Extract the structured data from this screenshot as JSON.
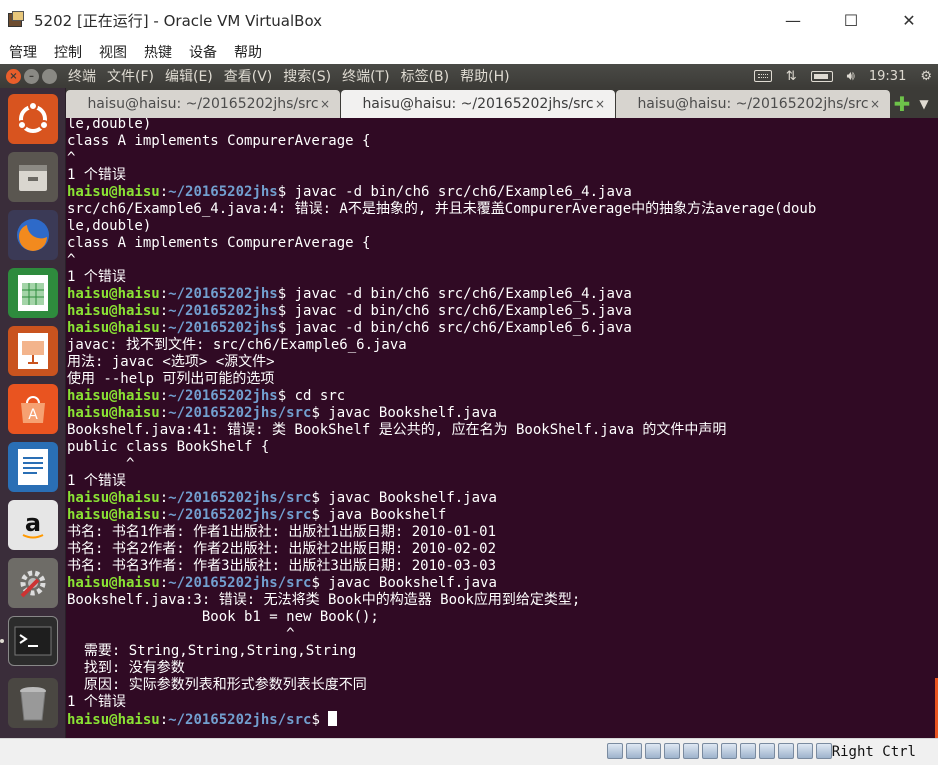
{
  "host_window": {
    "title": "5202 [正在运行] - Oracle VM VirtualBox",
    "controls": {
      "minimize": "—",
      "maximize": "☐",
      "close": "✕"
    },
    "menu": [
      "管理",
      "控制",
      "视图",
      "热键",
      "设备",
      "帮助"
    ]
  },
  "guest_panel": {
    "menu": [
      "终端",
      "文件(F)",
      "编辑(E)",
      "查看(V)",
      "搜索(S)",
      "终端(T)",
      "标签(B)",
      "帮助(H)"
    ],
    "time": "19:31",
    "indicators": [
      "keyboard-icon",
      "network-icon",
      "battery-icon",
      "volume-icon",
      "gear-icon"
    ]
  },
  "launcher": {
    "items": [
      {
        "name": "ubuntu-dash-icon",
        "color": "#d8541f"
      },
      {
        "name": "files-icon",
        "color": "#7a7a72"
      },
      {
        "name": "firefox-icon",
        "color": "#e66000"
      },
      {
        "name": "libreoffice-calc-icon",
        "color": "#2e8b3d"
      },
      {
        "name": "libreoffice-impress-icon",
        "color": "#c9531e"
      },
      {
        "name": "software-center-icon",
        "color": "#e95420"
      },
      {
        "name": "libreoffice-writer-icon",
        "color": "#2a6fb5"
      },
      {
        "name": "amazon-icon",
        "color": "#e0e0e0"
      },
      {
        "name": "system-settings-icon",
        "color": "#9a9a9a"
      },
      {
        "name": "terminal-icon",
        "color": "#2c2c2c"
      },
      {
        "name": "trash-icon",
        "color": "#8a8a8a"
      }
    ]
  },
  "tabs": [
    {
      "label": "haisu@haisu: ~/20165202jhs/src",
      "active": false
    },
    {
      "label": "haisu@haisu: ~/20165202jhs/src",
      "active": true
    },
    {
      "label": "haisu@haisu: ~/20165202jhs/src",
      "active": false
    }
  ],
  "tab_close_glyph": "×",
  "terminal": {
    "lines": [
      {
        "text": "le,double)"
      },
      {
        "text": "class A implements CompurerAverage {"
      },
      {
        "text": "^"
      },
      {
        "text": "1 个错误"
      },
      {
        "user": "haisu@haisu",
        "path": "~/20165202jhs",
        "cmd": " javac -d bin/ch6 src/ch6/Example6_4.java"
      },
      {
        "text": "src/ch6/Example6_4.java:4: 错误: A不是抽象的, 并且未覆盖CompurerAverage中的抽象方法average(doub"
      },
      {
        "text": "le,double)"
      },
      {
        "text": "class A implements CompurerAverage {"
      },
      {
        "text": "^"
      },
      {
        "text": "1 个错误"
      },
      {
        "user": "haisu@haisu",
        "path": "~/20165202jhs",
        "cmd": " javac -d bin/ch6 src/ch6/Example6_4.java"
      },
      {
        "user": "haisu@haisu",
        "path": "~/20165202jhs",
        "cmd": " javac -d bin/ch6 src/ch6/Example6_5.java"
      },
      {
        "user": "haisu@haisu",
        "path": "~/20165202jhs",
        "cmd": " javac -d bin/ch6 src/ch6/Example6_6.java"
      },
      {
        "text": "javac: 找不到文件: src/ch6/Example6_6.java"
      },
      {
        "text": "用法: javac <选项> <源文件>"
      },
      {
        "text": "使用 --help 可列出可能的选项"
      },
      {
        "user": "haisu@haisu",
        "path": "~/20165202jhs",
        "cmd": " cd src"
      },
      {
        "user": "haisu@haisu",
        "path": "~/20165202jhs/src",
        "cmd": " javac Bookshelf.java"
      },
      {
        "text": "Bookshelf.java:41: 错误: 类 BookShelf 是公共的, 应在名为 BookShelf.java 的文件中声明"
      },
      {
        "text": "public class BookShelf {"
      },
      {
        "text": "       ^"
      },
      {
        "text": "1 个错误"
      },
      {
        "user": "haisu@haisu",
        "path": "~/20165202jhs/src",
        "cmd": " javac Bookshelf.java"
      },
      {
        "user": "haisu@haisu",
        "path": "~/20165202jhs/src",
        "cmd": " java Bookshelf"
      },
      {
        "text": "书名: 书名1作者: 作者1出版社: 出版社1出版日期: 2010-01-01"
      },
      {
        "text": "书名: 书名2作者: 作者2出版社: 出版社2出版日期: 2010-02-02"
      },
      {
        "text": "书名: 书名3作者: 作者3出版社: 出版社3出版日期: 2010-03-03"
      },
      {
        "user": "haisu@haisu",
        "path": "~/20165202jhs/src",
        "cmd": " javac Bookshelf.java"
      },
      {
        "text": "Bookshelf.java:3: 错误: 无法将类 Book中的构造器 Book应用到给定类型;"
      },
      {
        "text": "                Book b1 = new Book();"
      },
      {
        "text": "                          ^"
      },
      {
        "text": "  需要: String,String,String,String"
      },
      {
        "text": "  找到: 没有参数"
      },
      {
        "text": "  原因: 实际参数列表和形式参数列表长度不同"
      },
      {
        "text": "1 个错误"
      },
      {
        "user": "haisu@haisu",
        "path": "~/20165202jhs/src",
        "cmd": " ",
        "cursor": true
      }
    ]
  },
  "status_bar": {
    "host_key": "Right Ctrl",
    "icons": [
      "hard-disk-icon",
      "optical-drive-icon",
      "audio-icon",
      "network-adapter-icon",
      "usb-icon",
      "shared-folders-icon",
      "display-icon",
      "video-capture-icon",
      "drag-drop-icon",
      "cpu-icon",
      "mouse-integration-icon",
      "arrow-down-icon"
    ]
  },
  "colors": {
    "terminal_bg": "#300a24",
    "prompt_user": "#8ae234",
    "prompt_path": "#729fcf",
    "accent": "#e95420"
  }
}
